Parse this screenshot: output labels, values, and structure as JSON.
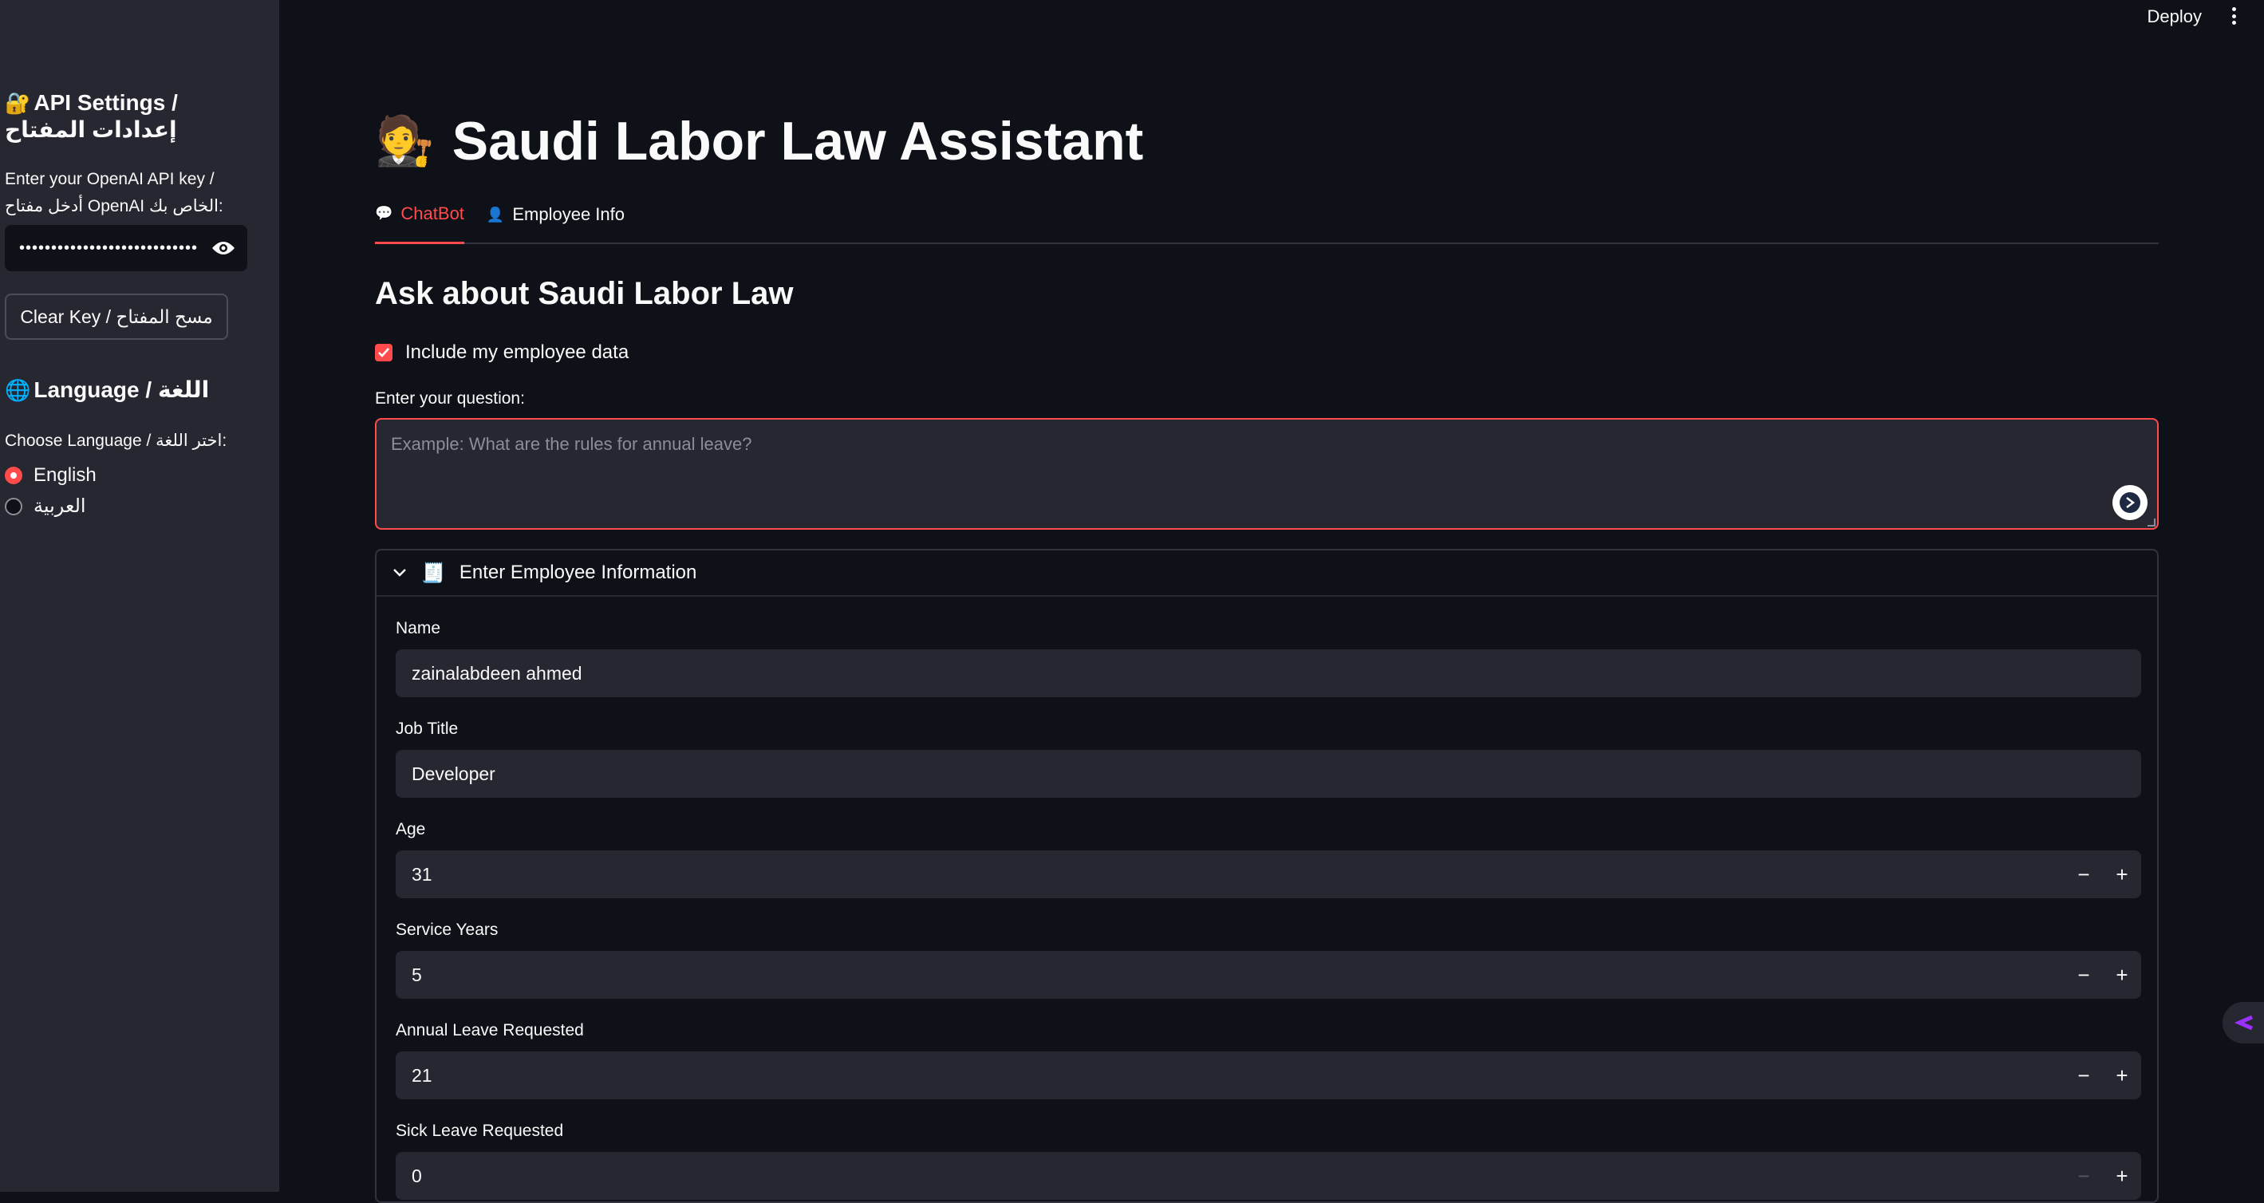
{
  "topbar": {
    "deploy_label": "Deploy"
  },
  "sidebar": {
    "api_heading": "API Settings / إعدادات المفتاح",
    "api_emoji": "🔐",
    "api_key_label_line1": "Enter your OpenAI API key /",
    "api_key_label_line2": "أدخل مفتاح OpenAI الخاص بك:",
    "api_key_masked": "••••••••••••••••••••••••••••",
    "clear_key_label": "Clear Key / مسح المفتاح",
    "language_heading": "Language / اللغة",
    "language_emoji": "🌐",
    "choose_language_label": "Choose Language / اختر اللغة:",
    "language_options": [
      "English",
      "العربية"
    ],
    "selected_language": "English"
  },
  "main": {
    "title_emoji": "🧑‍⚖️",
    "title": "Saudi Labor Law Assistant",
    "tabs": [
      {
        "icon": "💬",
        "label": "ChatBot",
        "active": true
      },
      {
        "icon": "👤",
        "label": "Employee Info",
        "active": false
      }
    ],
    "section_heading": "Ask about Saudi Labor Law",
    "include_data_label": "Include my employee data",
    "include_data_checked": true,
    "question_label": "Enter your question:",
    "question_placeholder": "Example: What are the rules for annual leave?",
    "question_value": ""
  },
  "employee_form": {
    "expander_icon": "🧾",
    "expander_title": "Enter Employee Information",
    "name_label": "Name",
    "name_value": "zainalabdeen ahmed",
    "job_title_label": "Job Title",
    "job_title_value": "Developer",
    "age_label": "Age",
    "age_value": "31",
    "service_years_label": "Service Years",
    "service_years_value": "5",
    "annual_leave_label": "Annual Leave Requested",
    "annual_leave_value": "21",
    "sick_leave_label": "Sick Leave Requested",
    "sick_leave_value": "0"
  },
  "colors": {
    "accent": "#ff4b4b",
    "background": "#0e1117",
    "sidebar": "#262730"
  }
}
